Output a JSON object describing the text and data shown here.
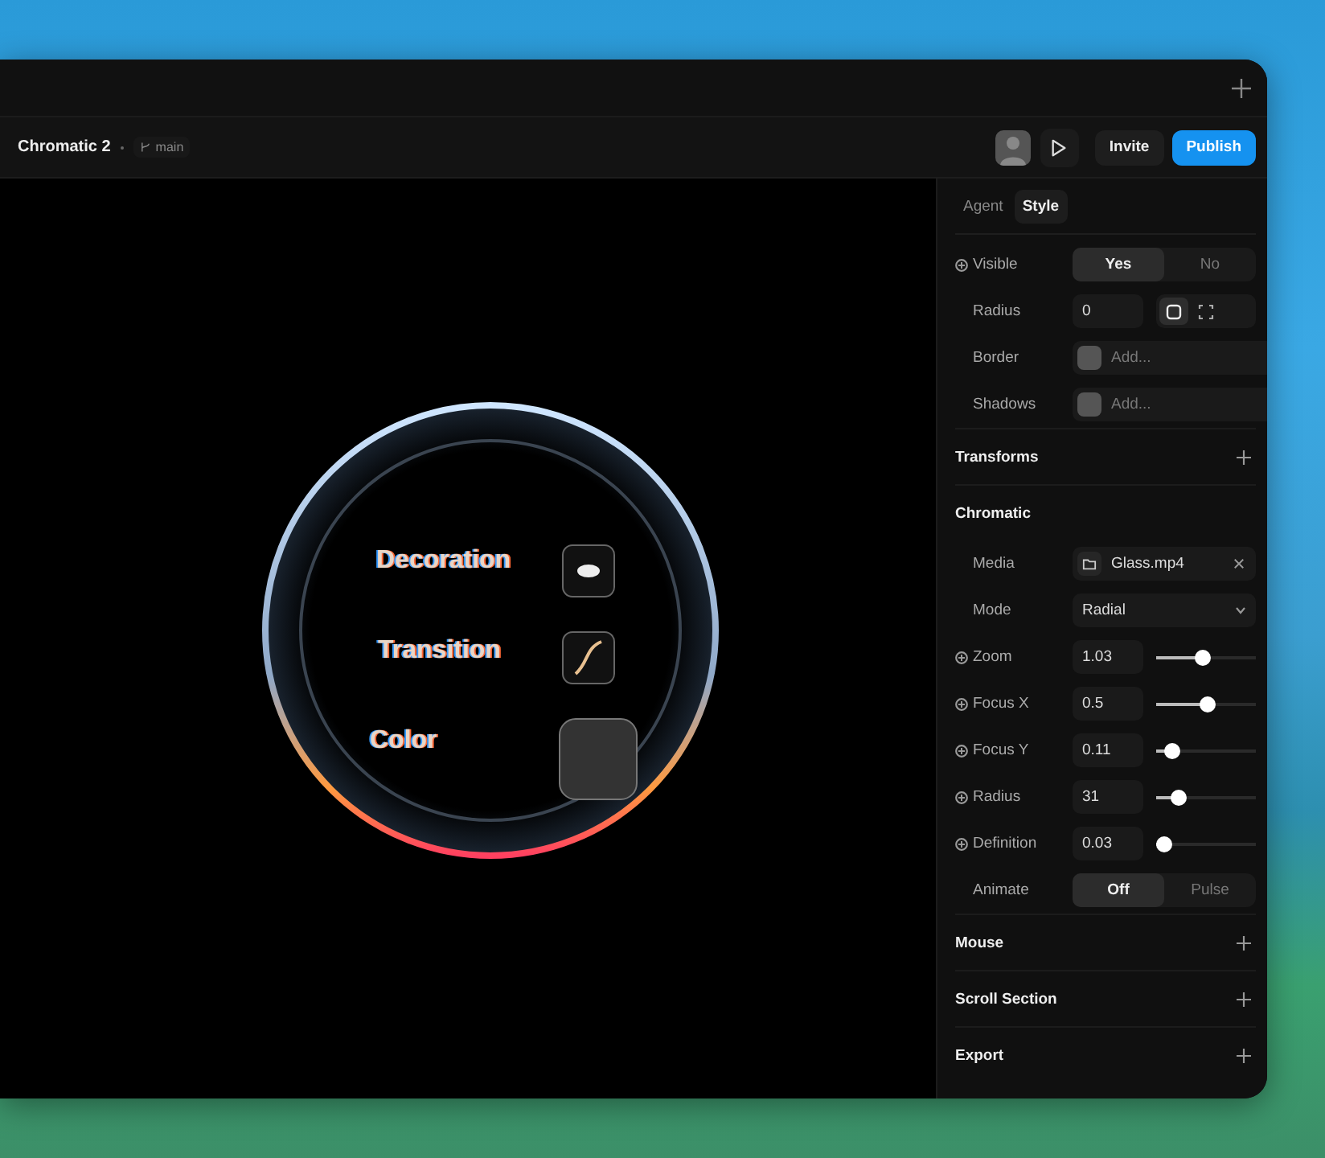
{
  "project": {
    "title": "Chromatic 2",
    "branch": "main"
  },
  "toolbar": {
    "buttons": [
      {
        "label": "Invite",
        "kind": "secondary"
      },
      {
        "label": "Publish",
        "kind": "primary"
      }
    ]
  },
  "canvas": {
    "labels": [
      "Decoration",
      "Transition",
      "Color"
    ]
  },
  "panel": {
    "tabs": [
      {
        "label": "Agent",
        "selected": false
      },
      {
        "label": "Style",
        "selected": true
      }
    ],
    "properties": [
      {
        "kind": "segmented",
        "label": "Visible",
        "animatable": true,
        "options": [
          {
            "label": "Yes",
            "selected": true
          },
          {
            "label": "No",
            "selected": false
          }
        ]
      },
      {
        "kind": "number-shape",
        "label": "Radius",
        "animatable": false,
        "value": "0",
        "shapes": [
          {
            "kind": "uniform",
            "selected": true
          },
          {
            "kind": "corners",
            "selected": false
          }
        ]
      },
      {
        "kind": "fill",
        "label": "Border",
        "animatable": false,
        "placeholder": "Add..."
      },
      {
        "kind": "fill",
        "label": "Shadows",
        "animatable": false,
        "placeholder": "Add..."
      }
    ],
    "sections": [
      {
        "title": "Transforms",
        "expanded": false
      },
      {
        "title": "Chromatic",
        "expanded": true,
        "rows": [
          {
            "kind": "file",
            "label": "Media",
            "animatable": false,
            "value": "Glass.mp4"
          },
          {
            "kind": "select",
            "label": "Mode",
            "animatable": false,
            "value": "Radial"
          },
          {
            "kind": "slider",
            "label": "Zoom",
            "animatable": true,
            "value": "1.03",
            "level": 0.47
          },
          {
            "kind": "slider",
            "label": "Focus X",
            "animatable": true,
            "value": "0.5",
            "level": 0.52
          },
          {
            "kind": "slider",
            "label": "Focus Y",
            "animatable": true,
            "value": "0.11",
            "level": 0.16
          },
          {
            "kind": "slider",
            "label": "Radius",
            "animatable": true,
            "value": "31",
            "level": 0.22
          },
          {
            "kind": "slider",
            "label": "Definition",
            "animatable": true,
            "value": "0.03",
            "level": 0.08
          },
          {
            "kind": "segmented",
            "label": "Animate",
            "animatable": false,
            "options": [
              {
                "label": "Off",
                "selected": true
              },
              {
                "label": "Pulse",
                "selected": false
              }
            ]
          }
        ]
      },
      {
        "title": "Mouse",
        "expanded": false
      },
      {
        "title": "Scroll Section",
        "expanded": false
      },
      {
        "title": "Export",
        "expanded": false
      }
    ]
  }
}
